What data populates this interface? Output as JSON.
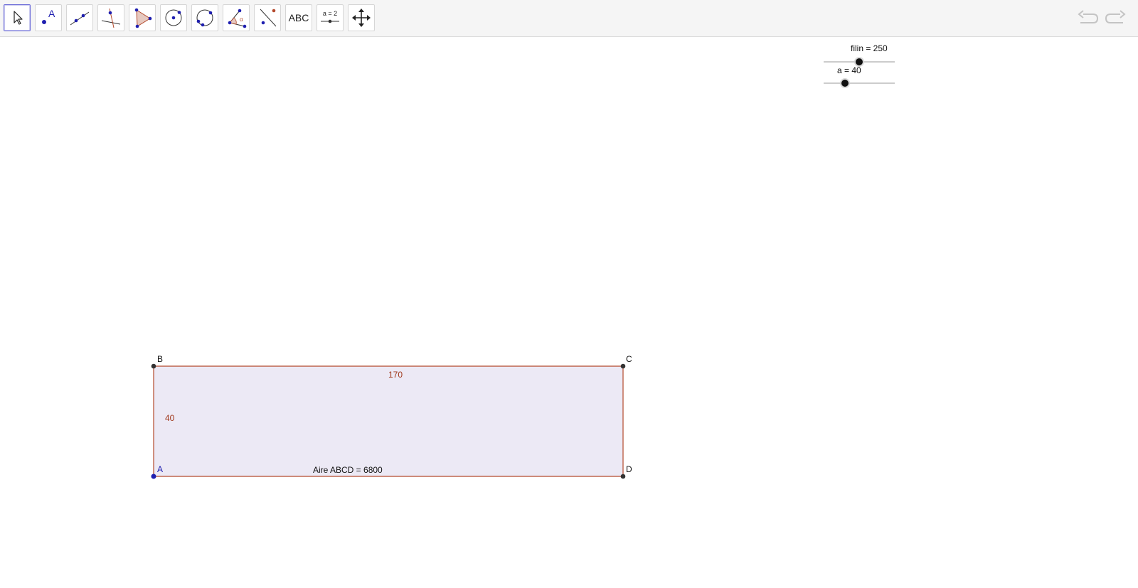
{
  "toolbar": {
    "tools": [
      {
        "name": "move",
        "icon": "move-cursor-icon",
        "active": true
      },
      {
        "name": "point",
        "icon": "point-icon",
        "label": "A"
      },
      {
        "name": "line",
        "icon": "line-icon"
      },
      {
        "name": "perpendicular-line",
        "icon": "perpendicular-line-icon"
      },
      {
        "name": "polygon",
        "icon": "polygon-icon"
      },
      {
        "name": "circle-center-point",
        "icon": "circle-center-icon"
      },
      {
        "name": "circle-three-points",
        "icon": "circle-three-points-icon"
      },
      {
        "name": "angle",
        "icon": "angle-icon",
        "label": "α"
      },
      {
        "name": "reflect",
        "icon": "reflect-icon"
      },
      {
        "name": "text",
        "icon": "text-icon",
        "label": "ABC"
      },
      {
        "name": "slider",
        "icon": "slider-icon",
        "label": "a = 2"
      },
      {
        "name": "move-graphics-view",
        "icon": "move-graphics-icon"
      }
    ],
    "undo_icon": "undo-icon",
    "redo_icon": "redo-icon"
  },
  "sliders": [
    {
      "label": "filin = 250",
      "name": "filin",
      "value": 250,
      "fraction": 0.5
    },
    {
      "label": "a = 40",
      "name": "a",
      "value": 40,
      "fraction": 0.3
    }
  ],
  "rectangle": {
    "vertices": {
      "A": "A",
      "B": "B",
      "C": "C",
      "D": "D"
    },
    "side_top": "170",
    "side_left": "40",
    "area_label": "Aire ABCD = 6800",
    "fill_color": "#ece9f5",
    "edge_color": "#b4492c"
  },
  "colors": {
    "accent": "#6b6bd8",
    "point_blue": "#1f1fb0",
    "point_dark": "#333333"
  }
}
